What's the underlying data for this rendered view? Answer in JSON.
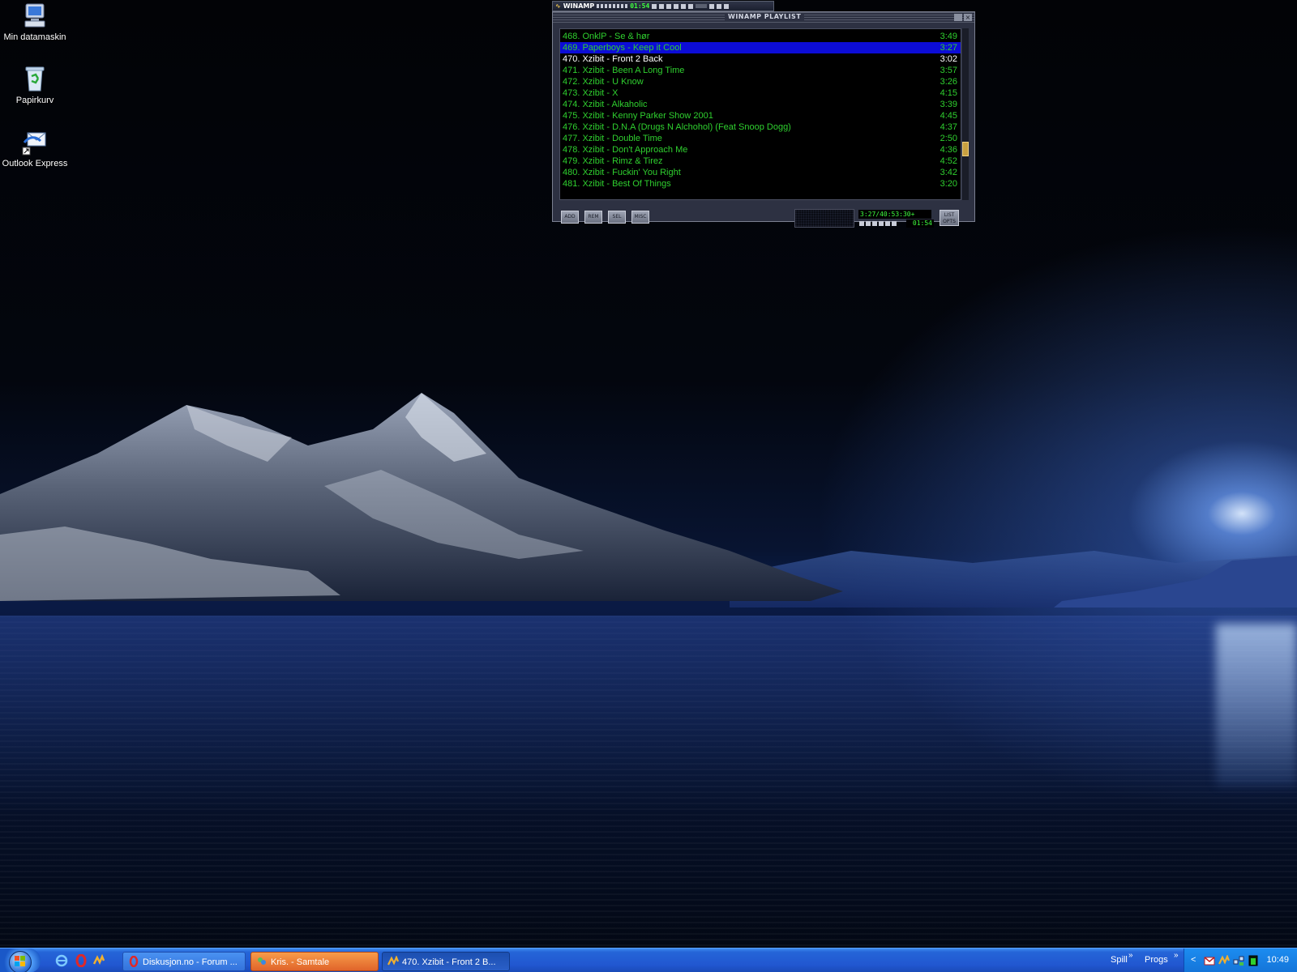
{
  "desktop": {
    "icons": [
      {
        "label": "Min datamaskin",
        "icon": "computer-icon"
      },
      {
        "label": "Papirkurv",
        "icon": "recycle-bin-icon"
      },
      {
        "label": "Outlook Express",
        "icon": "outlook-express-icon"
      }
    ]
  },
  "winamp": {
    "main": {
      "title": "WINAMP",
      "time": "01:54"
    },
    "playlist": {
      "title": "WINAMP PLAYLIST",
      "items": [
        {
          "title": "468. OnklP - Se & hør",
          "duration": "3:49",
          "state": "normal"
        },
        {
          "title": "469. Paperboys - Keep it Cool",
          "duration": "3:27",
          "state": "selected"
        },
        {
          "title": "470. Xzibit - Front 2 Back",
          "duration": "3:02",
          "state": "current"
        },
        {
          "title": "471. Xzibit - Been A Long Time",
          "duration": "3:57",
          "state": "normal"
        },
        {
          "title": "472. Xzibit - U Know",
          "duration": "3:26",
          "state": "normal"
        },
        {
          "title": "473. Xzibit - X",
          "duration": "4:15",
          "state": "normal"
        },
        {
          "title": "474. Xzibit - Alkaholic",
          "duration": "3:39",
          "state": "normal"
        },
        {
          "title": "475. Xzibit - Kenny Parker Show 2001",
          "duration": "4:45",
          "state": "normal"
        },
        {
          "title": "476. Xzibit - D.N.A (Drugs N Alchohol) (Feat Snoop Dogg)",
          "duration": "4:37",
          "state": "normal"
        },
        {
          "title": "477. Xzibit - Double Time",
          "duration": "2:50",
          "state": "normal"
        },
        {
          "title": "478. Xzibit - Don't Approach Me",
          "duration": "4:36",
          "state": "normal"
        },
        {
          "title": "479. Xzibit - Rimz & Tirez",
          "duration": "4:52",
          "state": "normal"
        },
        {
          "title": "480. Xzibit - Fuckin' You Right",
          "duration": "3:42",
          "state": "normal"
        },
        {
          "title": "481. Xzibit - Best Of Things",
          "duration": "3:20",
          "state": "normal"
        }
      ],
      "buttons": {
        "add": "ADD",
        "rem": "REM",
        "sel": "SEL",
        "misc": "MISC",
        "list_opts_1": "LIST",
        "list_opts_2": "OPTS"
      },
      "time_info": "3:27/40:53:30+",
      "elapsed": "01:54"
    }
  },
  "taskbar": {
    "tasks": [
      {
        "label": "Diskusjon.no - Forum ...",
        "state": "normal",
        "icon": "opera-icon"
      },
      {
        "label": "Kris. - Samtale",
        "state": "active",
        "icon": "messenger-icon"
      },
      {
        "label": "470. Xzibit - Front 2 B...",
        "state": "pressed",
        "icon": "winamp-icon"
      }
    ],
    "toolbars": {
      "spill": "Spill",
      "progs": "Progs",
      "chevron": "»",
      "expand": "<"
    },
    "clock": "10:49"
  },
  "colors": {
    "playlist_text": "#2fd02f",
    "playlist_current": "#ffffff",
    "playlist_selected_bg": "#0c0cd6",
    "taskbar": "#2157d0",
    "active_task": "#e0642a"
  }
}
